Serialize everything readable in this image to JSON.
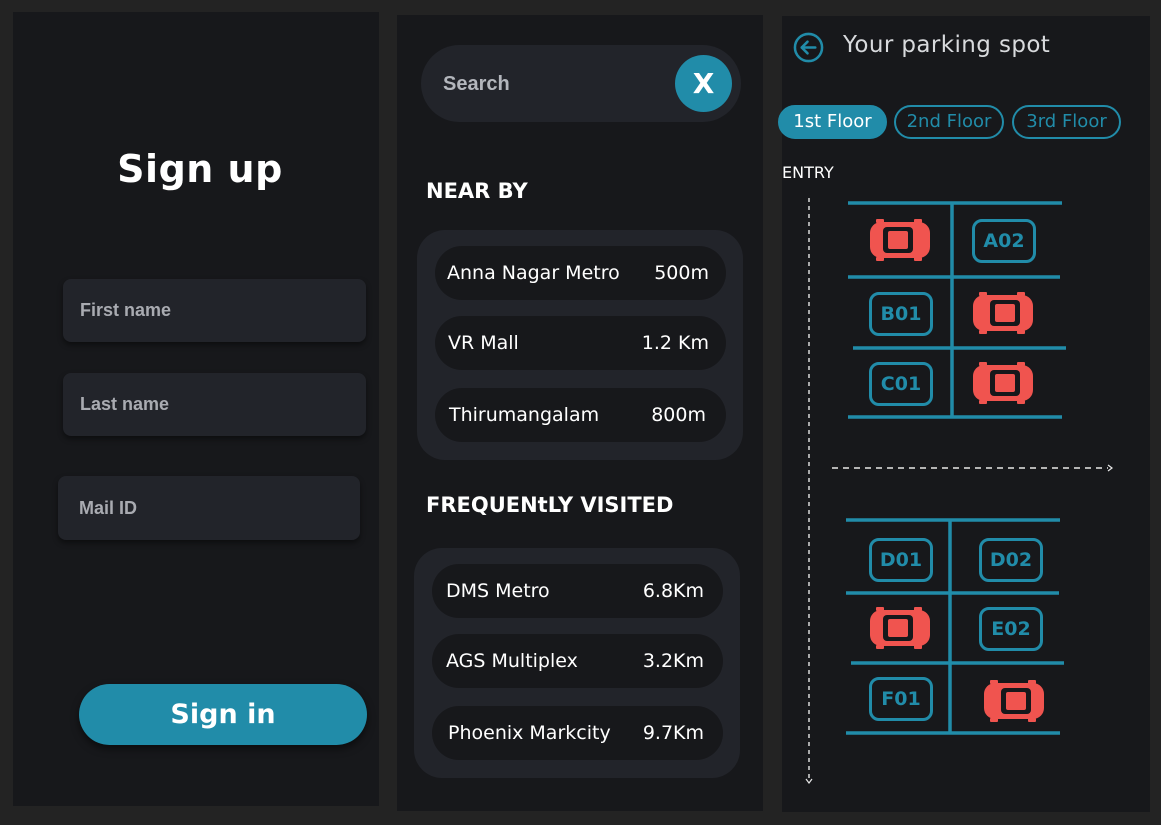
{
  "signup": {
    "title": "Sign up",
    "first_name_placeholder": "First name",
    "last_name_placeholder": "Last name",
    "mail_placeholder": "Mail ID",
    "signin_label": "Sign in"
  },
  "search": {
    "placeholder": "Search",
    "clear_label": "X"
  },
  "nearby": {
    "heading": "NEAR BY",
    "items": [
      {
        "name": "Anna Nagar Metro",
        "distance": "500m"
      },
      {
        "name": "VR Mall",
        "distance": "1.2 Km"
      },
      {
        "name": "Thirumangalam",
        "distance": "800m"
      }
    ]
  },
  "frequent": {
    "heading": "FREQUENtLY VISITED",
    "items": [
      {
        "name": "DMS Metro",
        "distance": "6.8Km"
      },
      {
        "name": "AGS Multiplex",
        "distance": "3.2Km"
      },
      {
        "name": "Phoenix Markcity",
        "distance": "9.7Km"
      }
    ]
  },
  "parking": {
    "title": "Your parking spot",
    "floors": [
      "1st Floor",
      "2nd Floor",
      "3rd Floor"
    ],
    "active_floor": "1st Floor",
    "entry_label": "ENTRY",
    "spots": [
      "A02",
      "B01",
      "C01",
      "D01",
      "D02",
      "E02",
      "F01"
    ],
    "occupied_count": 5
  },
  "colors": {
    "accent": "#218ca9",
    "car": "#f0544f",
    "background": "#17181b",
    "surface": "#22242a"
  }
}
